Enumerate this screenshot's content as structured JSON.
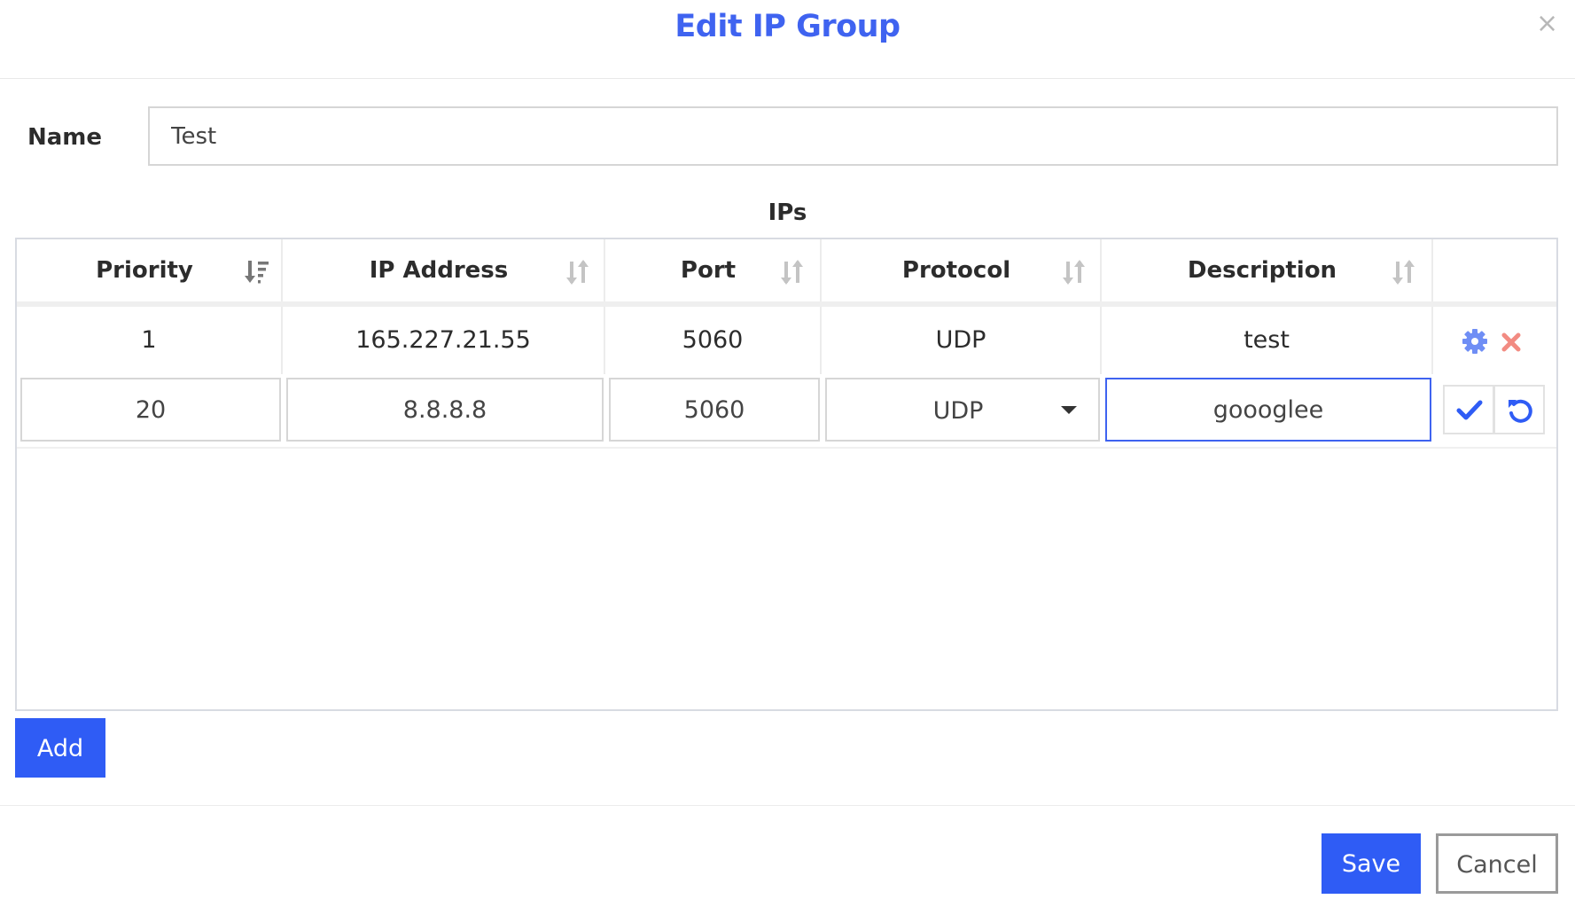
{
  "header": {
    "title": "Edit IP Group",
    "close_symbol": "×"
  },
  "form": {
    "name_label": "Name",
    "name_value": "Test"
  },
  "ips": {
    "section_title": "IPs",
    "columns": [
      {
        "label": "Priority",
        "sort": "sorted-desc"
      },
      {
        "label": "IP Address",
        "sort": "unsorted"
      },
      {
        "label": "Port",
        "sort": "unsorted"
      },
      {
        "label": "Protocol",
        "sort": "unsorted"
      },
      {
        "label": "Description",
        "sort": "unsorted"
      }
    ],
    "rows": [
      {
        "priority": "1",
        "ip": "165.227.21.55",
        "port": "5060",
        "protocol": "UDP",
        "description": "test"
      }
    ],
    "edit_row": {
      "priority": "20",
      "ip": "8.8.8.8",
      "port": "5060",
      "protocol": "UDP",
      "description": "goooglee"
    },
    "icons": {
      "edit": "gear-icon",
      "delete": "close-icon",
      "confirm": "check-icon",
      "revert": "undo-icon"
    }
  },
  "buttons": {
    "add": "Add",
    "save": "Save",
    "cancel": "Cancel"
  },
  "colors": {
    "accent": "#3f63f0",
    "primary_button": "#2f5cf5",
    "delete_icon": "#f28b82",
    "gear_icon": "#6f8ef5"
  }
}
